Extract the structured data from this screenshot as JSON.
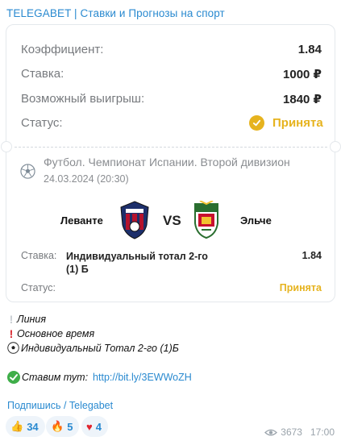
{
  "channel": {
    "title": "TELEGABET | Ставки и Прогнозы на спорт"
  },
  "summary": {
    "coef_label": "Коэффициент:",
    "coef_value": "1.84",
    "stake_label": "Ставка:",
    "stake_value": "1000 ₽",
    "win_label": "Возможный выигрыш:",
    "win_value": "1840 ₽",
    "status_label": "Статус:",
    "status_value": "Принята"
  },
  "match": {
    "sport": "Футбол. Чемпионат Испании. Второй дивизион",
    "date": "24.03.2024 (20:30)",
    "home": "Леванте",
    "vs": "VS",
    "away": "Эльче",
    "bet_label": "Ставка:",
    "bet_text": "Индивидуальный тотал 2-го (1) Б",
    "bet_odds": "1.84",
    "status_label": "Статус:",
    "status_value": "Принята"
  },
  "message": {
    "line1": "Линия",
    "line2": "Основное время",
    "line3": "Индивидуальный Тотал 2-го (1)Б",
    "place_label": "Ставим тут:",
    "link": "http://bit.ly/3EWWoZH",
    "subscribe": "Подпишись / Telegabet"
  },
  "reactions": [
    {
      "icon": "thumbs-up-icon",
      "count": "34"
    },
    {
      "icon": "fire-icon",
      "count": "5"
    },
    {
      "icon": "heart-icon",
      "count": "4"
    }
  ],
  "meta": {
    "views": "3673",
    "time": "17:00"
  },
  "colors": {
    "accent": "#2a8ad0",
    "status": "#e6b31e"
  }
}
